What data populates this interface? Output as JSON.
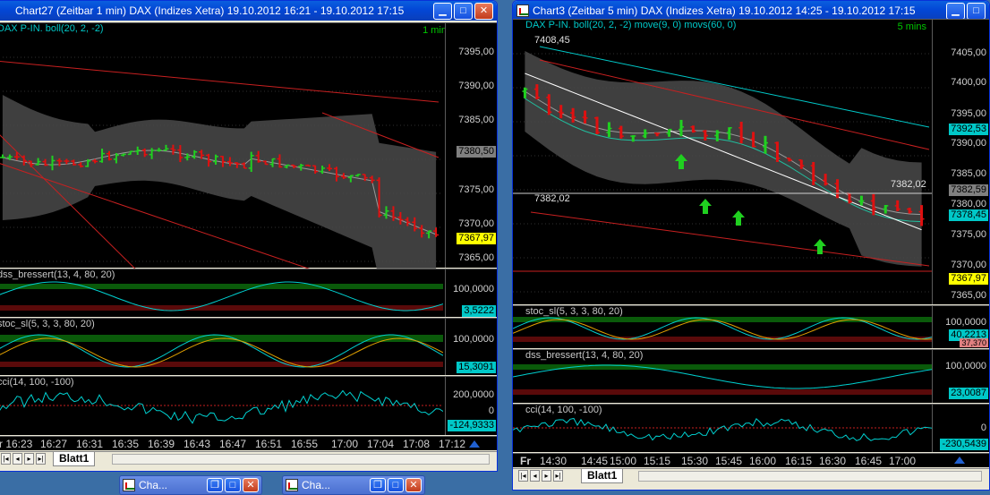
{
  "window1": {
    "title": "Chart27 (Zeitbar 1 min)  DAX (Indizes Xetra) 19.10.2012 16:21 - 19.10.2012 17:15",
    "price_pane": {
      "label": "DAX P-IN. boll(20, 2, -2)",
      "timeframe": "1 min",
      "ticks": [
        "7395,00",
        "7390,00",
        "7385,00",
        "7380,00",
        "7375,00",
        "7370,00",
        "7365,00"
      ],
      "tags": {
        "upper": "7380,50",
        "last": "7367,97"
      }
    },
    "ind1": {
      "label": "dss_bressert(13, 4, 80, 20)",
      "ticks": [
        "100,0000"
      ],
      "value": "3,5222"
    },
    "ind2": {
      "label": "stoc_sl(5, 3, 3, 80, 20)",
      "ticks": [
        "100,0000"
      ],
      "value": "15,3091"
    },
    "ind3": {
      "label": "cci(14, 100, -100)",
      "ticks": [
        "200,0000",
        "0"
      ],
      "value": "-124,9333"
    },
    "time_axis": [
      "r 16:23",
      "16:27",
      "16:31",
      "16:35",
      "16:39",
      "16:43",
      "16:47",
      "16:51",
      "16:55",
      "17:00",
      "17:04",
      "17:08",
      "17:12"
    ],
    "sheet_tab": "Blatt1"
  },
  "window2": {
    "title": "Chart3 (Zeitbar 5 min)  DAX (Indizes Xetra) 19.10.2012 14:25 - 19.10.2012 17:15",
    "price_pane": {
      "label": "DAX P-IN. boll(20, 2, -2) move(9, 0) movs(60, 0)",
      "timeframe": "5 mins",
      "high_label": "7408,45",
      "ticks": [
        "7405,00",
        "7400,00",
        "7395,00",
        "7390,00",
        "7385,00",
        "7380,00",
        "7375,00",
        "7370,00",
        "7365,00"
      ],
      "line_left": "7382,02",
      "line_right": "7382,02",
      "tags": {
        "cyan": "7392,53",
        "grey": "7382,59",
        "green": "7378,45",
        "last": "7367,97"
      }
    },
    "ind1": {
      "label": "stoc_sl(5, 3, 3, 80, 20)",
      "ticks": [
        "100,0000"
      ],
      "value": "40,2213",
      "value2": "37,370"
    },
    "ind2": {
      "label": "dss_bressert(13, 4, 80, 20)",
      "ticks": [
        "100,0000"
      ],
      "value": "23,0087"
    },
    "ind3": {
      "label": "cci(14, 100, -100)",
      "ticks": [
        "0"
      ],
      "value": "-230,5439"
    },
    "time_axis": [
      "Fr",
      "14:30",
      "14:45",
      "15:00",
      "15:15",
      "15:30",
      "15:45",
      "16:00",
      "16:15",
      "16:30",
      "16:45",
      "17:00"
    ],
    "sheet_tab": "Blatt1"
  },
  "taskbar": [
    {
      "label": "Cha..."
    },
    {
      "label": "Cha..."
    }
  ],
  "colors": {
    "up": "#20d020",
    "down": "#e01010",
    "band": "#4a4a4a",
    "cyan": "#00e0e0",
    "yellow_tag": "#ffff00"
  }
}
